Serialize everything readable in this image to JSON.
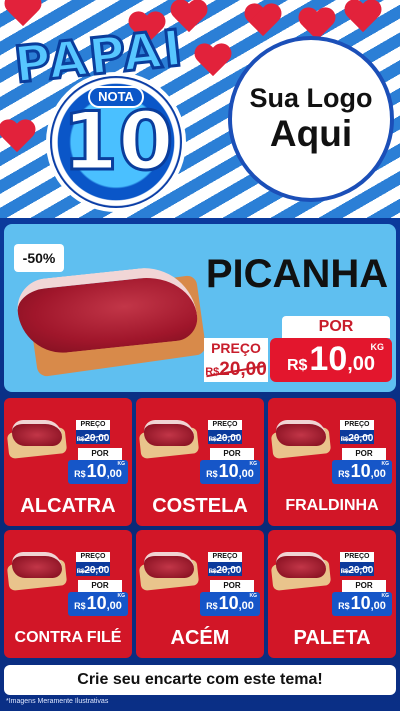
{
  "header": {
    "badge": {
      "top_word": "PAPAI",
      "pill": "NOTA",
      "number": "10"
    },
    "logo": {
      "line1": "Sua Logo",
      "line2": "Aqui"
    }
  },
  "hero": {
    "discount": "-50%",
    "name": "PICANHA",
    "old_label": "PREÇO",
    "old_currency": "R$",
    "old_value": "20,00",
    "new_label": "POR",
    "new_currency": "R$",
    "new_value": "10",
    "new_cents": ",00",
    "unit": "KG"
  },
  "products": [
    {
      "name": "ALCATRA",
      "old_label": "PREÇO",
      "old_currency": "R$",
      "old_value": "20,00",
      "new_label": "POR",
      "new_currency": "R$",
      "new_value": "10",
      "new_cents": ",00",
      "unit": "KG"
    },
    {
      "name": "COSTELA",
      "old_label": "PREÇO",
      "old_currency": "R$",
      "old_value": "20,00",
      "new_label": "POR",
      "new_currency": "R$",
      "new_value": "10",
      "new_cents": ",00",
      "unit": "KG"
    },
    {
      "name": "FRALDINHA",
      "old_label": "PREÇO",
      "old_currency": "R$",
      "old_value": "20,00",
      "new_label": "POR",
      "new_currency": "R$",
      "new_value": "10",
      "new_cents": ",00",
      "unit": "KG"
    },
    {
      "name": "CONTRA FILÉ",
      "old_label": "PREÇO",
      "old_currency": "R$",
      "old_value": "20,00",
      "new_label": "POR",
      "new_currency": "R$",
      "new_value": "10",
      "new_cents": ",00",
      "unit": "KG"
    },
    {
      "name": "ACÉM",
      "old_label": "PREÇO",
      "old_currency": "R$",
      "old_value": "20,00",
      "new_label": "POR",
      "new_currency": "R$",
      "new_value": "10",
      "new_cents": ",00",
      "unit": "KG"
    },
    {
      "name": "PALETA",
      "old_label": "PREÇO",
      "old_currency": "R$",
      "old_value": "20,00",
      "new_label": "POR",
      "new_currency": "R$",
      "new_value": "10",
      "new_cents": ",00",
      "unit": "KG"
    }
  ],
  "footer": {
    "cta": "Crie seu encarte com este tema!",
    "disclaimer": "*Imagens Meramente Ilustrativas"
  },
  "colors": {
    "brand_blue": "#0b2a7a",
    "accent_red": "#d21627",
    "hero_bg": "#5fbff0"
  },
  "icons": [
    "heart-icon"
  ]
}
